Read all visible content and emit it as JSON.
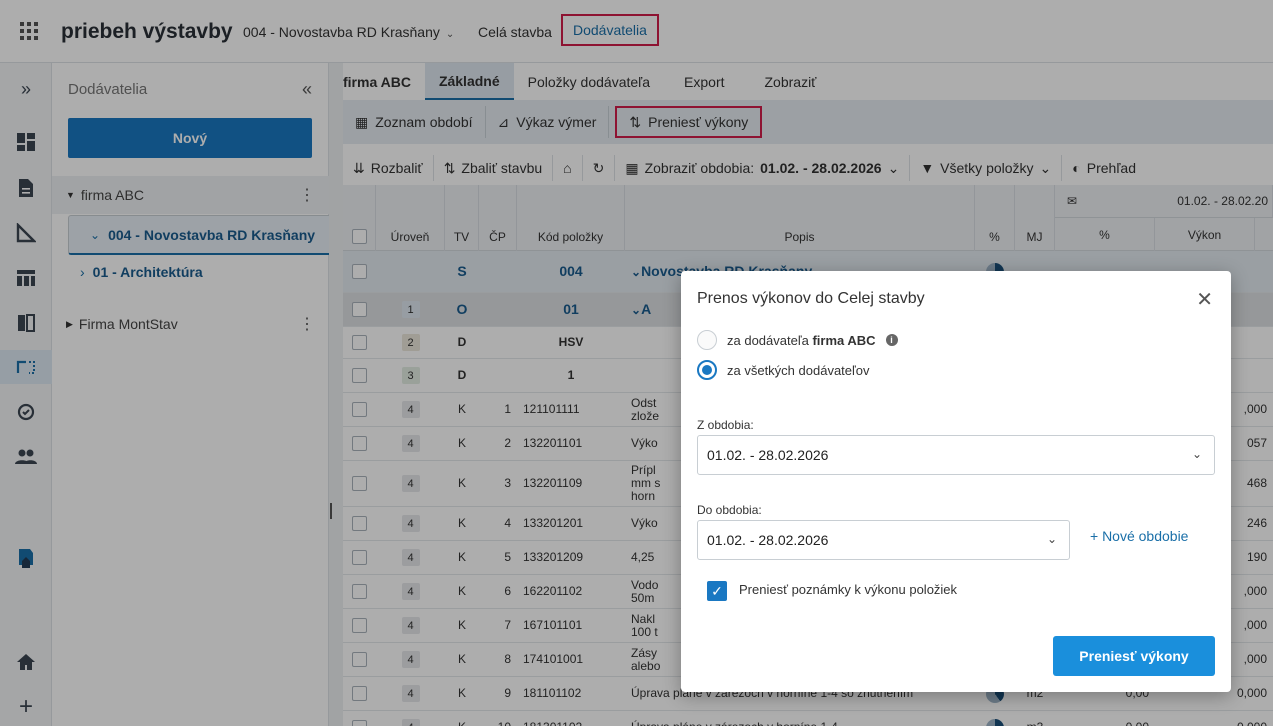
{
  "header": {
    "app_title": "priebeh výstavby",
    "project": "004 - Novostavba RD Krasňany",
    "nav": [
      "Celá stavba",
      "Dodávatelia"
    ]
  },
  "sidebar": {
    "title": "Dodávatelia",
    "new_button": "Nový",
    "items": [
      {
        "label": "firma ABC"
      },
      {
        "label": "004 - Novostavba RD Krasňany"
      },
      {
        "label": "01 - Architektúra"
      },
      {
        "label": "Firma MontStav"
      }
    ]
  },
  "tabs": {
    "firm": "firma ABC",
    "items": [
      "Základné",
      "Položky dodávateľa",
      "Export",
      "Zobraziť"
    ]
  },
  "toolbar": {
    "periods": "Zoznam období",
    "report": "Výkaz výmer",
    "transfer": "Preniesť výkony"
  },
  "toolbar2": {
    "expand": "Rozbaliť",
    "collapse": "Zbaliť stavbu",
    "period_label": "Zobraziť obdobia:",
    "period_value": "01.02. - 28.02.2026",
    "filter": "Všetky položky",
    "overview": "Prehľad"
  },
  "table": {
    "headers": [
      "Úroveň",
      "TV",
      "ČP",
      "Kód položky",
      "Popis",
      "%",
      "MJ"
    ],
    "group_header": "01.02. - 28.02.20",
    "sub_headers": [
      "%",
      "Výkon"
    ],
    "rows": [
      {
        "lvl": "",
        "tv": "S",
        "cp": "",
        "kod": "004",
        "popis": "Novostavba RD Krasňany",
        "mj": "",
        "p": "",
        "v": ""
      },
      {
        "lvl": "1",
        "tv": "O",
        "cp": "",
        "kod": "01",
        "popis": "A",
        "mj": "",
        "p": "",
        "v": ""
      },
      {
        "lvl": "2",
        "tv": "D",
        "cp": "",
        "kod": "HSV",
        "popis": "",
        "mj": "",
        "p": "",
        "v": ""
      },
      {
        "lvl": "3",
        "tv": "D",
        "cp": "",
        "kod": "1",
        "popis": "",
        "mj": "",
        "p": "",
        "v": ""
      },
      {
        "lvl": "4",
        "tv": "K",
        "cp": "1",
        "kod": "121101111",
        "popis": "Odst\nzlože",
        "mj": "",
        "p": "",
        "v": ",000"
      },
      {
        "lvl": "4",
        "tv": "K",
        "cp": "2",
        "kod": "132201101",
        "popis": "Výko",
        "mj": "",
        "p": "",
        "v": "057"
      },
      {
        "lvl": "4",
        "tv": "K",
        "cp": "3",
        "kod": "132201109",
        "popis": "Prípl\nmm s\nhorn",
        "mj": "",
        "p": "",
        "v": "468"
      },
      {
        "lvl": "4",
        "tv": "K",
        "cp": "4",
        "kod": "133201201",
        "popis": "Výko",
        "mj": "",
        "p": "",
        "v": "246"
      },
      {
        "lvl": "4",
        "tv": "K",
        "cp": "5",
        "kod": "133201209",
        "popis": "4,25",
        "mj": "",
        "p": "",
        "v": "190"
      },
      {
        "lvl": "4",
        "tv": "K",
        "cp": "6",
        "kod": "162201102",
        "popis": "Vodo\n50m",
        "mj": "",
        "p": "",
        "v": ",000"
      },
      {
        "lvl": "4",
        "tv": "K",
        "cp": "7",
        "kod": "167101101",
        "popis": "Nakl\n100 t",
        "mj": "",
        "p": "",
        "v": ",000"
      },
      {
        "lvl": "4",
        "tv": "K",
        "cp": "8",
        "kod": "174101001",
        "popis": "Zásy\nalebo",
        "mj": "",
        "p": "",
        "v": ",000"
      },
      {
        "lvl": "4",
        "tv": "K",
        "cp": "9",
        "kod": "181101102",
        "popis": "Úprava pláne v zárezoch v horníne 1-4 so zhutnením",
        "mj": "m2",
        "p": "0,00",
        "v": "0,000"
      },
      {
        "lvl": "4",
        "tv": "K",
        "cp": "10",
        "kod": "181301102",
        "popis": "Úprava pláne v zárezoch v horníne 1-4",
        "mj": "m3",
        "p": "0,00",
        "v": "0,000"
      }
    ]
  },
  "dialog": {
    "title": "Prenos výkonov do Celej stavby",
    "opt1_prefix": "za dodávateľa ",
    "opt1_bold": "firma ABC",
    "opt2": "za všetkých dodávateľov",
    "from_label": "Z obdobia:",
    "from_value": "01.02. - 28.02.2026",
    "to_label": "Do obdobia:",
    "to_value": "01.02. - 28.02.2026",
    "new_period": "+ Nové obdobie",
    "notes": "Preniesť poznámky k výkonu položiek",
    "submit": "Preniesť výkony"
  }
}
